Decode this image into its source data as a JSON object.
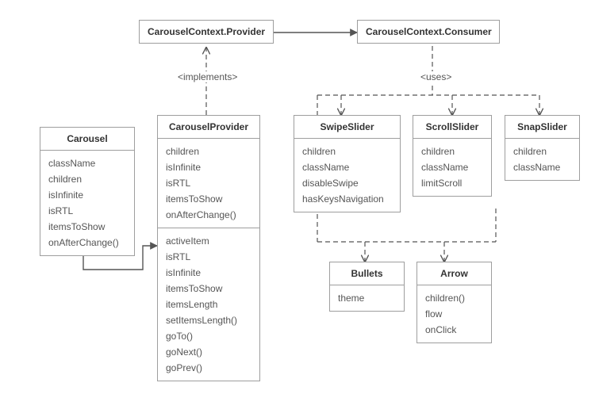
{
  "labels": {
    "implements": "<implements>",
    "uses": "<uses>"
  },
  "nodes": {
    "ctxProvider": {
      "title": "CarouselContext.Provider"
    },
    "ctxConsumer": {
      "title": "CarouselContext.Consumer"
    },
    "carousel": {
      "title": "Carousel",
      "props": [
        "className",
        "children",
        "isInfinite",
        "isRTL",
        "itemsToShow",
        "onAfterChange()"
      ]
    },
    "carouselProvider": {
      "title": "CarouselProvider",
      "props": [
        "children",
        "isInfinite",
        "isRTL",
        "itemsToShow",
        "onAfterChange()"
      ],
      "state": [
        "activeItem",
        "isRTL",
        "isInfinite",
        "itemsToShow",
        "itemsLength",
        "setItemsLength()",
        "goTo()",
        "goNext()",
        "goPrev()"
      ]
    },
    "swipeSlider": {
      "title": "SwipeSlider",
      "props": [
        "children",
        "className",
        "disableSwipe",
        "hasKeysNavigation"
      ]
    },
    "scrollSlider": {
      "title": "ScrollSlider",
      "props": [
        "children",
        "className",
        "limitScroll"
      ]
    },
    "snapSlider": {
      "title": "SnapSlider",
      "props": [
        "children",
        "className"
      ]
    },
    "bullets": {
      "title": "Bullets",
      "props": [
        "theme"
      ]
    },
    "arrow": {
      "title": "Arrow",
      "props": [
        "children()",
        "flow",
        "onClick"
      ]
    }
  }
}
